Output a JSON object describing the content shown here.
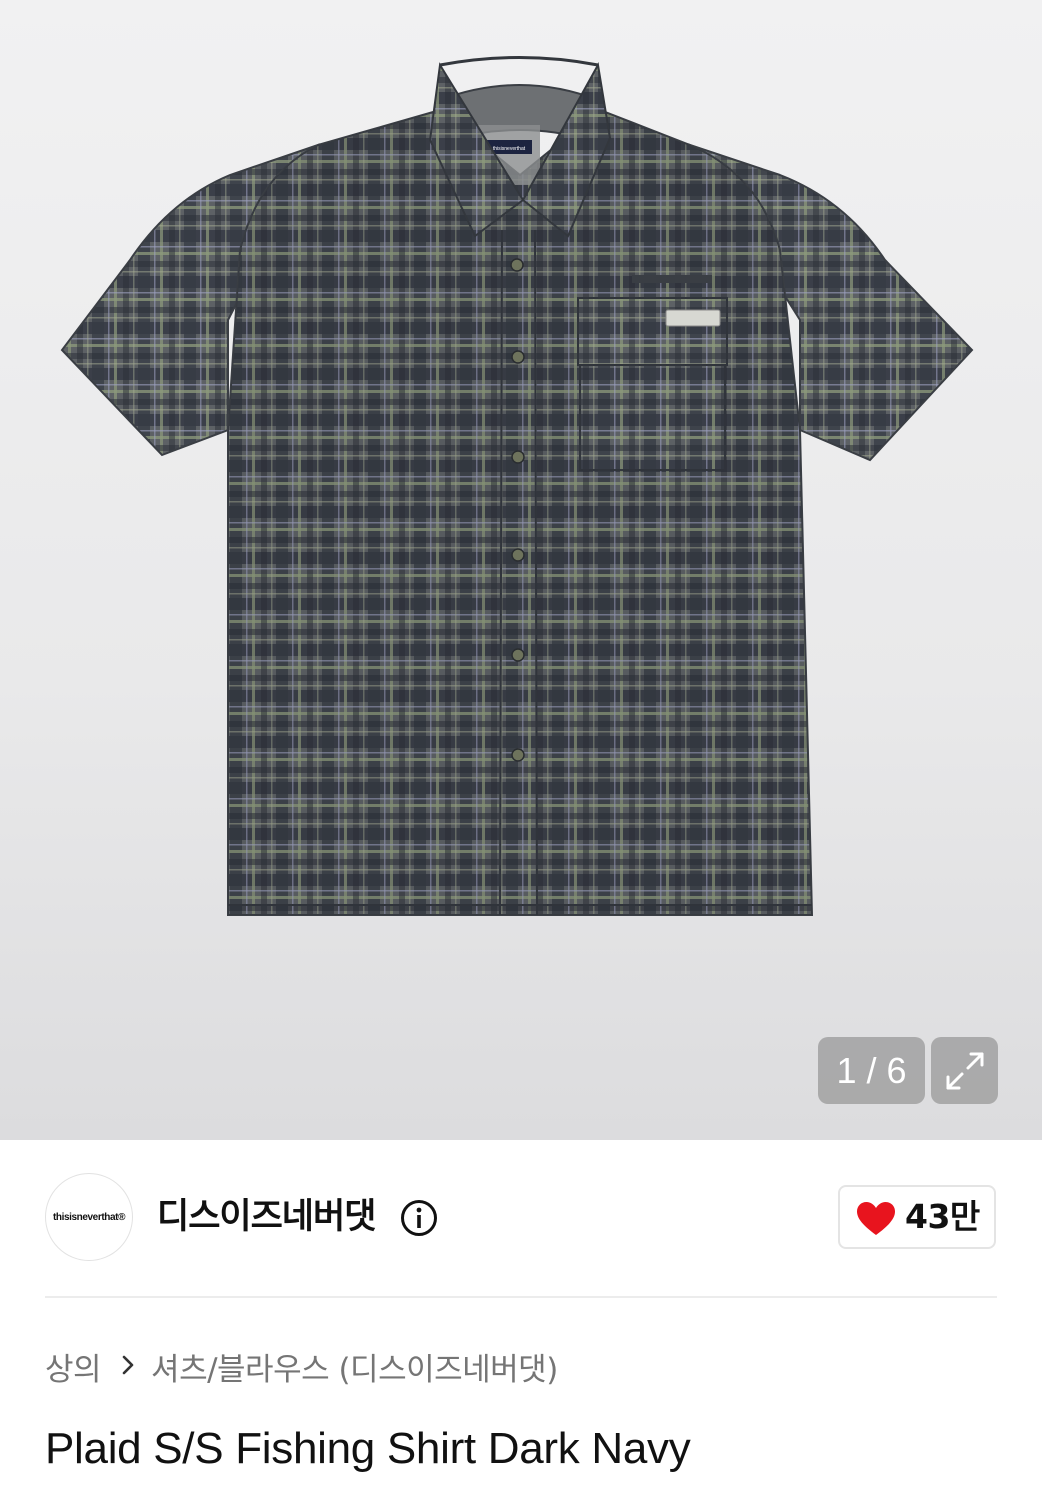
{
  "gallery": {
    "current_index": 1,
    "total": 6,
    "counter_text": "1 / 6",
    "expand_icon": "expand-arrows-icon",
    "product_image_logo_text": "thisisneverthat"
  },
  "brand": {
    "logo_text": "thisisneverthat®",
    "name": "디스이즈네버댓",
    "info_icon": "info-circle-icon",
    "like_icon": "heart-icon",
    "like_count": "43만",
    "like_color": "#e8141e"
  },
  "breadcrumb": {
    "category": "상의",
    "separator_icon": "chevron-right-icon",
    "subcategory": "셔츠/블라우스 (디스이즈네버댓)"
  },
  "product": {
    "title": "Plaid S/S Fishing Shirt Dark Navy"
  }
}
